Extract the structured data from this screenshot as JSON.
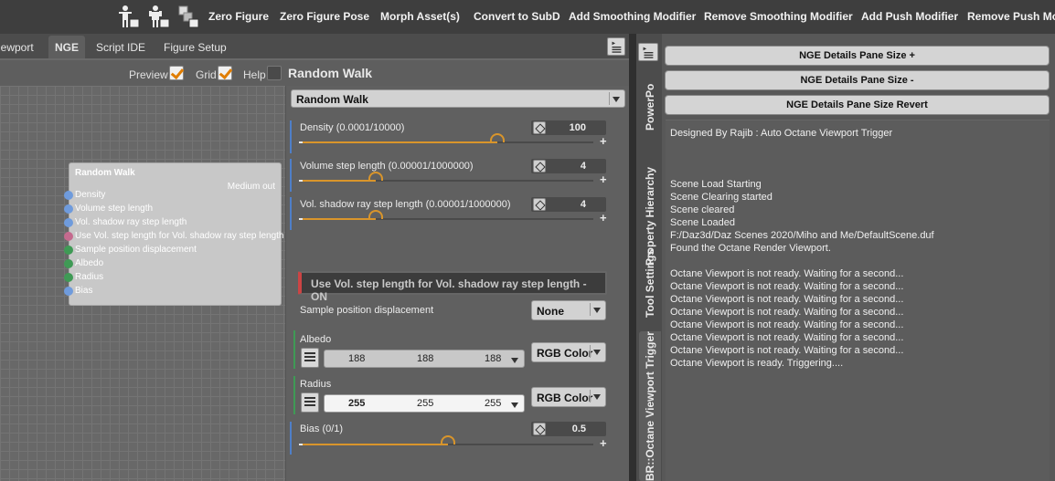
{
  "toolbar": {
    "icons": [
      "figure-zero-icon",
      "figure-pose-icon",
      "morph-asset-icon"
    ],
    "buttons": [
      "Zero Figure",
      "Zero Figure Pose",
      "Morph Asset(s)",
      "Convert to SubD",
      "Add Smoothing Modifier",
      "Remove Smoothing Modifier",
      "Add Push Modifier",
      "Remove Push Mo"
    ]
  },
  "tabs": [
    "iewport",
    "NGE",
    "Script IDE",
    "Figure Setup"
  ],
  "active_tab": "NGE",
  "options": {
    "preview_label": "Preview",
    "preview_checked": true,
    "grid_label": "Grid",
    "grid_checked": true,
    "help_label": "Help",
    "help_checked": false
  },
  "node_title": "Random Walk",
  "node": {
    "title": "Random Walk",
    "output": "Medium out",
    "ports": [
      {
        "label": "Density",
        "color": "#6f9bdc"
      },
      {
        "label": "Volume step length",
        "color": "#6f9bdc"
      },
      {
        "label": "Vol. shadow ray step length",
        "color": "#6f9bdc"
      },
      {
        "label": "Use Vol. step length for Vol. shadow ray step length",
        "color": "#c46a8e"
      },
      {
        "label": "Sample position displacement",
        "color": "#3f9a55"
      },
      {
        "label": "Albedo",
        "color": "#3f9a55"
      },
      {
        "label": "Radius",
        "color": "#3f9a55"
      },
      {
        "label": "Bias",
        "color": "#6f9bdc"
      }
    ]
  },
  "props": {
    "preset": "Random Walk",
    "density": {
      "label": "Density (0.0001/10000)",
      "value": "100",
      "slider_fraction": 0.67
    },
    "volume_step": {
      "label": "Volume step length (0.00001/1000000)",
      "value": "4",
      "slider_fraction": 0.25
    },
    "shadow_step": {
      "label": "Vol. shadow ray step length (0.00001/1000000)",
      "value": "4",
      "slider_fraction": 0.25
    },
    "toggle": "Use Vol. step length for Vol. shadow ray step length - ON",
    "displacement": {
      "label": "Sample position displacement",
      "value": "None"
    },
    "albedo": {
      "label": "Albedo",
      "r": "188",
      "g": "188",
      "b": "188",
      "mode": "RGB Color"
    },
    "radius": {
      "label": "Radius",
      "r": "255",
      "g": "255",
      "b": "255",
      "mode": "RGB Color"
    },
    "bias": {
      "label": "Bias (0/1)",
      "value": "0.5",
      "slider_fraction": 0.5
    }
  },
  "right_tabs": [
    "PowerPo",
    "Property Hierarchy",
    "Tool Settings",
    "BR::Octane Viewport Trigger"
  ],
  "right_active_tab": "BR::Octane Viewport Trigger",
  "pane_buttons": [
    "NGE Details Pane Size +",
    "NGE Details Pane Size -",
    "NGE Details Pane Size Revert"
  ],
  "log": [
    "Designed By Rajib : Auto Octane Viewport Trigger",
    "",
    "",
    "",
    "Scene Load Starting",
    "Scene Clearing started",
    "Scene cleared",
    "Scene Loaded",
    "F:/Daz3d/Daz Scenes 2020/Miho and Me/DefaultScene.duf",
    "Found the Octane Render Viewport.",
    "",
    "Octane Viewport is not ready. Waiting for a second...",
    "Octane Viewport is not ready. Waiting for a second...",
    "Octane Viewport is not ready. Waiting for a second...",
    "Octane Viewport is not ready. Waiting for a second...",
    "Octane Viewport is not ready. Waiting for a second...",
    "Octane Viewport is not ready. Waiting for a second...",
    "Octane Viewport is not ready. Waiting for a second...",
    "Octane Viewport is ready. Triggering...."
  ]
}
